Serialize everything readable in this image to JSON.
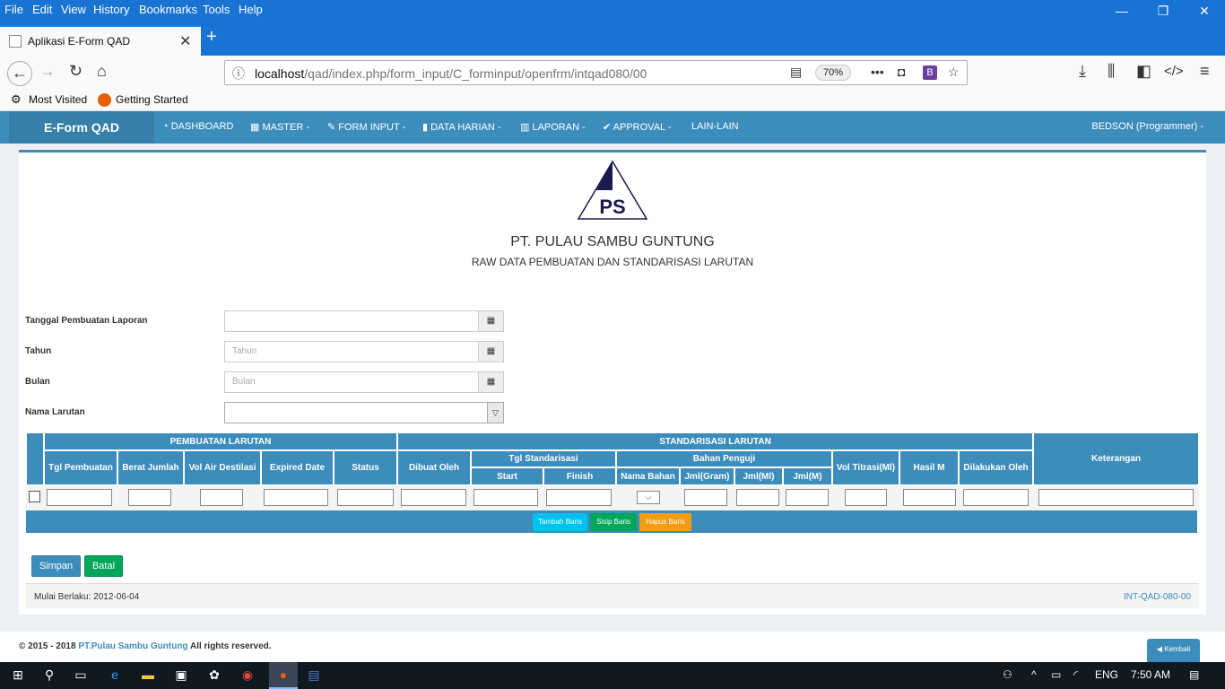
{
  "browser": {
    "menu": [
      "File",
      "Edit",
      "View",
      "History",
      "Bookmarks",
      "Tools",
      "Help"
    ],
    "tab_title": "Aplikasi E-Form QAD",
    "url_host": "localhost",
    "url_path": "/qad/index.php/form_input/C_forminput/openfrm/intqad080/00",
    "zoom": "70%",
    "bookmarks": [
      "Most Visited",
      "Getting Started"
    ]
  },
  "app": {
    "brand": "E-Form QAD",
    "nav": [
      "DASHBOARD",
      "MASTER -",
      "FORM INPUT -",
      "DATA HARIAN -",
      "LAPORAN -",
      "APPROVAL -",
      "LAIN-LAIN"
    ],
    "user": "BEDSON (Programmer) -"
  },
  "header": {
    "logo_text": "PS",
    "company": "PT. PULAU SAMBU GUNTUNG",
    "title": "RAW DATA PEMBUATAN DAN STANDARISASI LARUTAN"
  },
  "form": {
    "tanggal_label": "Tanggal Pembuatan Laporan",
    "tahun_label": "Tahun",
    "tahun_placeholder": "Tahun",
    "bulan_label": "Bulan",
    "bulan_placeholder": "Bulan",
    "nama_larutan_label": "Nama Larutan"
  },
  "table": {
    "group_pembuatan": "PEMBUATAN LARUTAN",
    "group_standarisasi": "STANDARISASI LARUTAN",
    "tgl_standarisasi": "Tgl Standarisasi",
    "bahan_penguji": "Bahan Penguji",
    "keterangan": "Keterangan",
    "cols": {
      "tgl_pembuatan": "Tgl Pembuatan",
      "berat_jumlah": "Berat Jumlah",
      "vol_air": "Vol Air Destilasi",
      "expired": "Expired Date",
      "status": "Status",
      "dibuat_oleh": "Dibuat Oleh",
      "start": "Start",
      "finish": "Finish",
      "nama_bahan": "Nama Bahan",
      "jml_gram": "Jml(Gram)",
      "jml_ml": "Jml(Ml)",
      "jml_m": "Jml(M)",
      "vol_titrasi": "Vol Titrasi(Ml)",
      "hasil_m": "Hasil M",
      "dilakukan_oleh": "Dilakukan Oleh"
    },
    "btn_tambah": "Tambah Baris",
    "btn_sisip": "Sisip Baris",
    "btn_hapus": "Hapus Baris"
  },
  "actions": {
    "simpan": "Simpan",
    "batal": "Batal"
  },
  "footer": {
    "berlaku": "Mulai Berlaku: 2012-06-04",
    "code": "INT-QAD-080-00",
    "copyright_pre": "© 2015 - 2018",
    "copyright_link": "PT.Pulau  Sambu Guntung",
    "copyright_post": "All rights reserved.",
    "kembali": "Kembali"
  },
  "taskbar": {
    "lang": "ENG",
    "time": "7:50 AM"
  },
  "colors": {
    "primary": "#3c8dbc",
    "success": "#00a65a",
    "info": "#00c0ef",
    "warning": "#f39c12",
    "browser_blue": "#1873d3"
  }
}
